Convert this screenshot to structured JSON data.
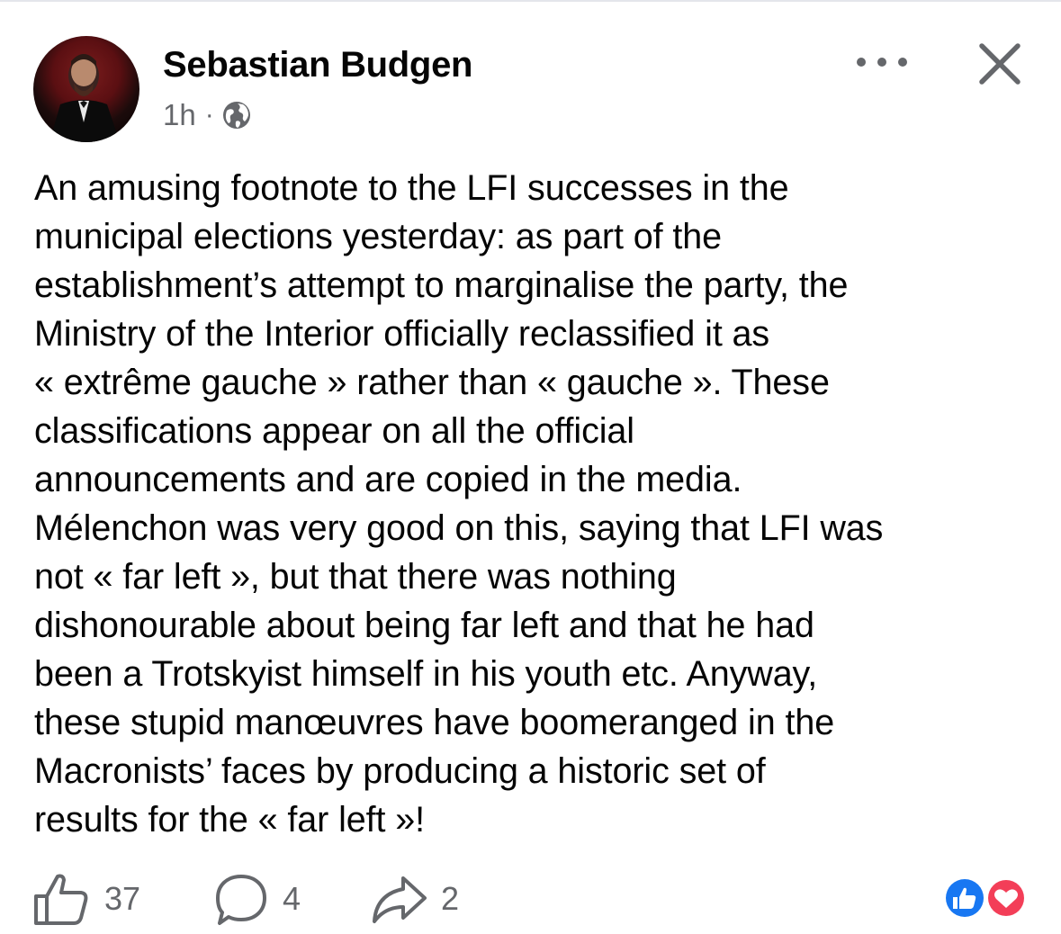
{
  "post": {
    "author": "Sebastian Budgen",
    "time": "1h",
    "separator": "·",
    "privacy_icon": "globe-icon",
    "menu_icon": "more-options-icon",
    "close_icon": "close-icon",
    "text_lines": [
      "An amusing footnote to the LFI successes in the",
      "municipal elections yesterday: as part of the",
      "establishment’s attempt to marginalise the party, the",
      "Ministry of the Interior officially reclassified it as",
      "« extrême gauche » rather than « gauche ». These",
      "classifications appear on all the official",
      "announcements and are copied in the media.",
      "Mélenchon was very good on this, saying that LFI was",
      "not « far left », but that there was nothing",
      "dishonourable about being far left and that he had",
      "been a Trotskyist himself in his youth etc. Anyway,",
      "these stupid manœuvres have boomeranged in the",
      "Macronists’ faces by producing a historic set of",
      "results for the « far left »!"
    ]
  },
  "actions": {
    "likes": "37",
    "comments": "4",
    "shares": "2"
  },
  "reactions": [
    "like",
    "love"
  ],
  "colors": {
    "text": "#050505",
    "secondary": "#65676b",
    "like_blue": "#1877f2",
    "love_red": "#f33e58"
  }
}
